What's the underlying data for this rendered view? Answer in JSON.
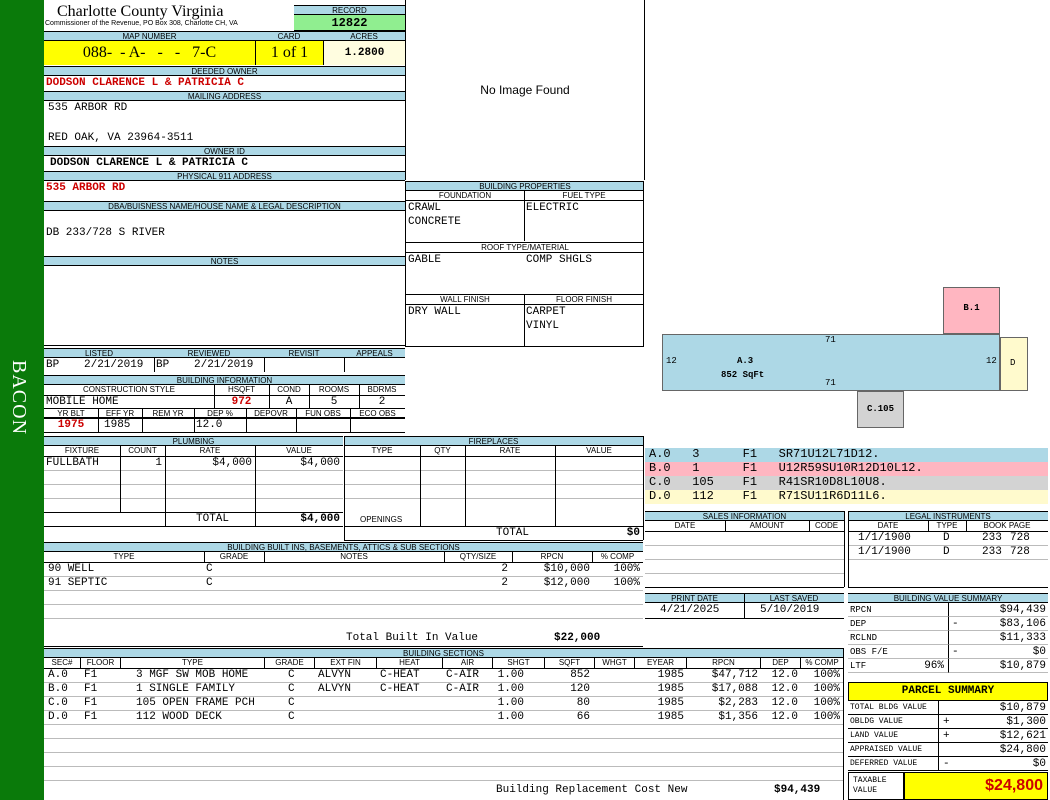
{
  "sidebar": {
    "text": "BACON"
  },
  "header": {
    "county": "Charlotte County Virginia",
    "commissioner": "Commissioner of the Revenue, PO Box 308, Charlotte CH, VA",
    "record_label": "RECORD",
    "record": "12822",
    "map_number_label": "MAP NUMBER",
    "map_number": "088-  - A-   -   -   7-C",
    "card_label": "CARD",
    "card": "1 of 1",
    "acres_label": "ACRES",
    "acres": "1.2800"
  },
  "owner": {
    "deeded_owner_label": "DEEDED OWNER",
    "deeded_owner": "DODSON CLARENCE L & PATRICIA C",
    "mailing_label": "MAILING ADDRESS",
    "mailing_line1": "535 ARBOR RD",
    "mailing_line2": "RED OAK, VA 23964-3511",
    "owner_id_label": "OWNER ID",
    "owner_id": "DODSON CLARENCE L & PATRICIA C",
    "physical_label": "PHYSICAL 911 ADDRESS",
    "physical": "535 ARBOR RD",
    "dba_label": "DBA/BUISNESS NAME/HOUSE NAME & LEGAL DESCRIPTION",
    "dba": "DB 233/728 S RIVER",
    "notes_label": "NOTES"
  },
  "image": {
    "text": "No Image Found"
  },
  "building_props": {
    "title": "BUILDING PROPERTIES",
    "foundation_label": "FOUNDATION",
    "fuel_label": "FUEL TYPE",
    "foundation": [
      "CRAWL",
      "CONCRETE"
    ],
    "fuel": [
      "ELECTRIC"
    ],
    "roof_label": "ROOF TYPE/MATERIAL",
    "roof_type": "GABLE",
    "roof_material": "COMP SHGLS",
    "wall_label": "WALL FINISH",
    "floor_label": "FLOOR FINISH",
    "wall": [
      "DRY WALL"
    ],
    "floor": [
      "CARPET",
      "VINYL"
    ]
  },
  "dates": {
    "listed_label": "LISTED",
    "reviewed_label": "REVIEWED",
    "revisit_label": "REVISIT",
    "appeals_label": "APPEALS",
    "listed_code": "BP",
    "listed": "2/21/2019",
    "reviewed_code": "BP",
    "reviewed": "2/21/2019"
  },
  "building_info": {
    "title": "BUILDING INFORMATION",
    "labels": [
      "CONSTRUCTION STYLE",
      "HSQFT",
      "COND",
      "ROOMS",
      "BDRMS"
    ],
    "construction_style": "MOBILE HOME",
    "hsqft": "972",
    "cond": "A",
    "rooms": "5",
    "bdrms": "2",
    "labels2": [
      "YR BLT",
      "EFF YR",
      "REM YR",
      "DEP %",
      "DEPOVR",
      "FUN OBS",
      "ECO OBS"
    ],
    "yr_blt": "1975",
    "eff_yr": "1985",
    "dep_pct": "12.0"
  },
  "plumbing": {
    "title": "PLUMBING",
    "headers": [
      "FIXTURE",
      "COUNT",
      "RATE",
      "VALUE"
    ],
    "rows": [
      {
        "fixture": "FULLBATH",
        "count": "1",
        "rate": "$4,000",
        "value": "$4,000"
      }
    ],
    "total_label": "TOTAL",
    "total": "$4,000"
  },
  "fireplaces": {
    "title": "FIREPLACES",
    "headers": [
      "TYPE",
      "QTY",
      "RATE",
      "VALUE"
    ],
    "openings_label": "OPENINGS",
    "total_label": "TOTAL",
    "total": "$0"
  },
  "built_ins": {
    "title": "BUILDING BUILT INS, BASEMENTS, ATTICS & SUB SECTIONS",
    "headers": [
      "TYPE",
      "GRADE",
      "NOTES",
      "QTY/SIZE",
      "RPCN",
      "% COMP"
    ],
    "rows": [
      {
        "type": "90 WELL",
        "grade": "C",
        "qty": "2",
        "rpcn": "$10,000",
        "comp": "100%"
      },
      {
        "type": "91 SEPTIC",
        "grade": "C",
        "qty": "2",
        "rpcn": "$12,000",
        "comp": "100%"
      }
    ],
    "total_label": "Total Built In Value",
    "total": "$22,000"
  },
  "sketch": {
    "b1": "B.1",
    "a3": "A.3",
    "a3_area": "852 SqFt",
    "top_dim": "71",
    "bottom_dim": "71",
    "left_dim": "12",
    "right_dim": "12",
    "d": "D",
    "c105": "C.105"
  },
  "segments": [
    {
      "code": "A.0",
      "num": "3",
      "floor": "F1",
      "path": "SR71U12L71D12.",
      "color": "#add8e6"
    },
    {
      "code": "B.0",
      "num": "1",
      "floor": "F1",
      "path": "U12R59SU10R12D10L12.",
      "color": "#ffb6c1"
    },
    {
      "code": "C.0",
      "num": "105",
      "floor": "F1",
      "path": "R41SR10D8L10U8.",
      "color": "#d3d3d3"
    },
    {
      "code": "D.0",
      "num": "112",
      "floor": "F1",
      "path": "R71SU11R6D11L6.",
      "color": "#fffacd"
    }
  ],
  "sales": {
    "title": "SALES INFORMATION",
    "headers": [
      "DATE",
      "AMOUNT",
      "CODE"
    ]
  },
  "legal": {
    "title": "LEGAL INSTRUMENTS",
    "headers": [
      "DATE",
      "TYPE",
      "BOOK PAGE"
    ],
    "rows": [
      {
        "date": "1/1/1900",
        "type": "D",
        "book": "233",
        "page": "728"
      },
      {
        "date": "1/1/1900",
        "type": "D",
        "book": "233",
        "page": "728"
      }
    ]
  },
  "print_info": {
    "print_label": "PRINT DATE",
    "saved_label": "LAST SAVED",
    "print_date": "4/21/2025",
    "last_saved": "5/10/2019"
  },
  "value_summary": {
    "title": "BUILDING VALUE SUMMARY",
    "rows": [
      {
        "label": "RPCN",
        "sign": "",
        "pct": "",
        "value": "$94,439"
      },
      {
        "label": "DEP",
        "sign": "-",
        "pct": "",
        "value": "$83,106"
      },
      {
        "label": "RCLND",
        "sign": "",
        "pct": "",
        "value": "$11,333"
      },
      {
        "label": "OBS F/E",
        "sign": "-",
        "pct": "",
        "value": "$0"
      },
      {
        "label": "LTF",
        "sign": "",
        "pct": "96%",
        "value": "$10,879"
      }
    ]
  },
  "parcel": {
    "title": "PARCEL SUMMARY",
    "rows": [
      {
        "label": "TOTAL BLDG VALUE",
        "sign": "",
        "value": "$10,879"
      },
      {
        "label": "OBLDG VALUE",
        "sign": "+",
        "value": "$1,300"
      },
      {
        "label": "LAND VALUE",
        "sign": "+",
        "value": "$12,621"
      },
      {
        "label": "APPRAISED VALUE",
        "sign": "",
        "value": "$24,800"
      },
      {
        "label": "DEFERRED VALUE",
        "sign": "-",
        "value": "$0"
      }
    ],
    "taxable_label": "TAXABLE VALUE",
    "taxable": "$24,800"
  },
  "sections": {
    "title": "BUILDING SECTIONS",
    "headers": [
      "SEC#",
      "FLOOR",
      "TYPE",
      "GRADE",
      "EXT FIN",
      "HEAT",
      "AIR",
      "SHGT",
      "SQFT",
      "WHGT",
      "EYEAR",
      "RPCN",
      "DEP",
      "% COMP"
    ],
    "rows": [
      {
        "sec": "A.0",
        "floor": "F1",
        "type": "3 MGF SW MOB HOME",
        "grade": "C",
        "ext": "ALVYN",
        "heat": "C-HEAT",
        "air": "C-AIR",
        "shgt": "1.00",
        "sqft": "852",
        "whgt": "",
        "eyear": "1985",
        "rpcn": "$47,712",
        "dep": "12.0",
        "comp": "100%"
      },
      {
        "sec": "B.0",
        "floor": "F1",
        "type": "1 SINGLE FAMILY",
        "grade": "C",
        "ext": "ALVYN",
        "heat": "C-HEAT",
        "air": "C-AIR",
        "shgt": "1.00",
        "sqft": "120",
        "whgt": "",
        "eyear": "1985",
        "rpcn": "$17,088",
        "dep": "12.0",
        "comp": "100%"
      },
      {
        "sec": "C.0",
        "floor": "F1",
        "type": "105 OPEN FRAME PCH",
        "grade": "C",
        "ext": "",
        "heat": "",
        "air": "",
        "shgt": "1.00",
        "sqft": "80",
        "whgt": "",
        "eyear": "1985",
        "rpcn": "$2,283",
        "dep": "12.0",
        "comp": "100%"
      },
      {
        "sec": "D.0",
        "floor": "F1",
        "type": "112 WOOD DECK",
        "grade": "C",
        "ext": "",
        "heat": "",
        "air": "",
        "shgt": "1.00",
        "sqft": "66",
        "whgt": "",
        "eyear": "1985",
        "rpcn": "$1,356",
        "dep": "12.0",
        "comp": "100%"
      }
    ],
    "total_label": "Building Replacement Cost New",
    "total": "$94,439"
  }
}
